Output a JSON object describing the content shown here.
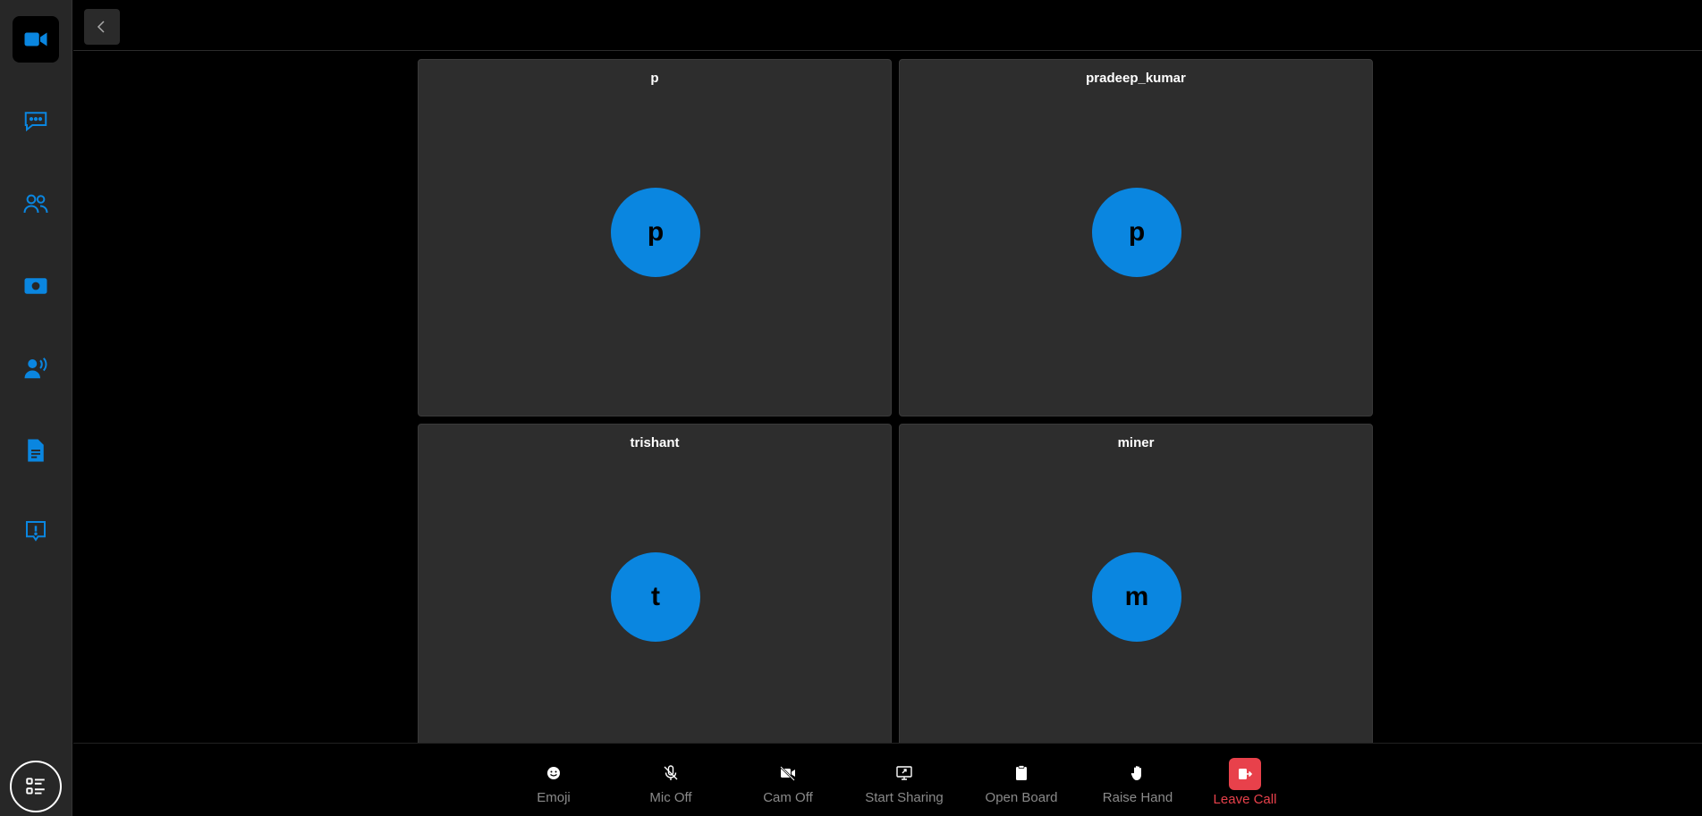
{
  "theme": {
    "accent": "#0a86e0",
    "danger": "#e8414b",
    "tile_bg": "#2d2d2d",
    "sidebar_bg": "#272727"
  },
  "sidebar": {
    "items": [
      {
        "icon": "video-camera-icon",
        "active": true
      },
      {
        "icon": "chat-icon"
      },
      {
        "icon": "participants-icon"
      },
      {
        "icon": "record-icon"
      },
      {
        "icon": "speaker-icon"
      },
      {
        "icon": "document-icon"
      },
      {
        "icon": "report-icon"
      }
    ],
    "menu_icon": "list-menu-icon"
  },
  "topbar": {
    "back_icon": "chevron-left-icon"
  },
  "participants": [
    {
      "name": "p",
      "initial": "p"
    },
    {
      "name": "pradeep_kumar",
      "initial": "p"
    },
    {
      "name": "trishant",
      "initial": "t"
    },
    {
      "name": "miner",
      "initial": "m"
    }
  ],
  "controls": {
    "emoji": "Emoji",
    "mic": "Mic Off",
    "cam": "Cam Off",
    "share": "Start Sharing",
    "board": "Open Board",
    "hand": "Raise Hand",
    "leave": "Leave Call"
  }
}
